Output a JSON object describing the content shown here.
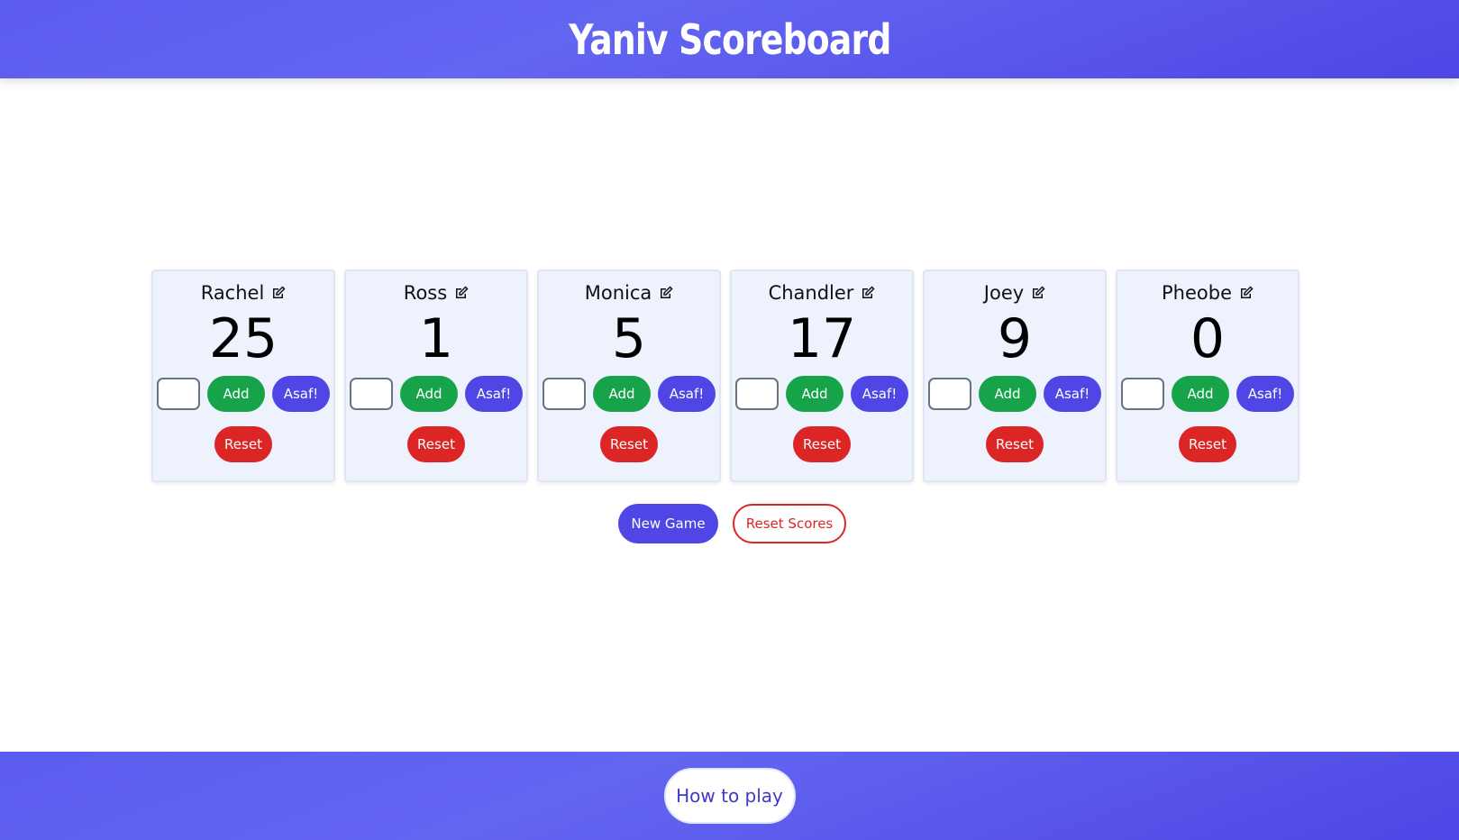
{
  "header": {
    "title": "Yaniv Scoreboard"
  },
  "players": [
    {
      "name": "Rachel",
      "score": "25",
      "add_label": "Add",
      "asaf_label": "Asaf!",
      "reset_label": "Reset",
      "input_value": ""
    },
    {
      "name": "Ross",
      "score": "1",
      "add_label": "Add",
      "asaf_label": "Asaf!",
      "reset_label": "Reset",
      "input_value": ""
    },
    {
      "name": "Monica",
      "score": "5",
      "add_label": "Add",
      "asaf_label": "Asaf!",
      "reset_label": "Reset",
      "input_value": ""
    },
    {
      "name": "Chandler",
      "score": "17",
      "add_label": "Add",
      "asaf_label": "Asaf!",
      "reset_label": "Reset",
      "input_value": ""
    },
    {
      "name": "Joey",
      "score": "9",
      "add_label": "Add",
      "asaf_label": "Asaf!",
      "reset_label": "Reset",
      "input_value": ""
    },
    {
      "name": "Pheobe",
      "score": "0",
      "add_label": "Add",
      "asaf_label": "Asaf!",
      "reset_label": "Reset",
      "input_value": ""
    }
  ],
  "icons": {
    "edit": "edit-icon"
  },
  "game_actions": {
    "new_game_label": "New Game",
    "reset_scores_label": "Reset Scores"
  },
  "footer": {
    "how_to_play_label": "How to play"
  },
  "colors": {
    "header_bg": "#5b5cf0",
    "add": "#16a34a",
    "asaf": "#4f46e5",
    "reset": "#dc2626",
    "card_bg": "#eef2fc"
  }
}
